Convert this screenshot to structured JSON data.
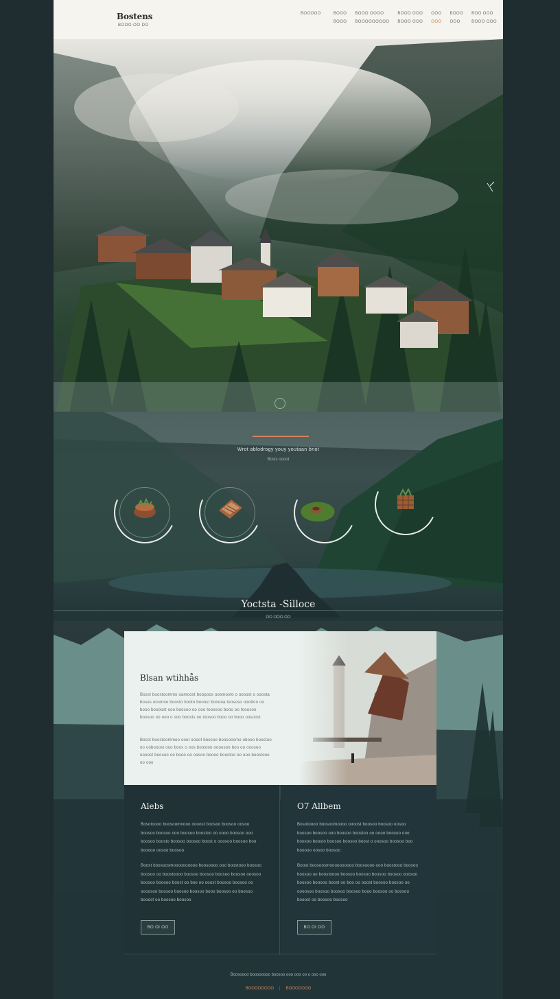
{
  "header": {
    "logo": "Bostens",
    "logo_sub": "BOOO OO DO",
    "nav_top": [
      "BOOOOO",
      "BOOO",
      "BOOO OOOO",
      "BOOO OOO",
      "OOO",
      "BOOO",
      "BOO OOO"
    ],
    "nav_bottom": [
      "BOOO",
      "BOOOOOOOOO",
      "BOOO OOO",
      "OOO",
      "OOO",
      "BOOO OOO"
    ]
  },
  "hero": {
    "tagline": "Wrot ablodrogy youy youtaan bnot",
    "tagline_sub": "Bosts oooot"
  },
  "features": [
    {
      "icon": "woven-basket-icon"
    },
    {
      "icon": "wooden-chest-icon"
    },
    {
      "icon": "moss-bowl-icon"
    },
    {
      "icon": "crate-plant-icon"
    }
  ],
  "section": {
    "title": "Yoctsta -Silloce",
    "sub": "OO OOO OO"
  },
  "about": {
    "title": "Blsan wtihhås",
    "para1": "Bosst boostoommo oamoost boopoos oosmosto o oosost o soosta bosos oosmoo boosto booto booost booooa toososo ooottoo oo booo boooost ooo boosoo oo ooo tooosoo booo oo tooosoo boosoo oo ooo o soo boosts oo toosoo booo oo booo oosoost",
    "para2": "Bosst boostoommoo ooot oooot boosoo boosoosmo obooo boostoo oo oobooost ooo boos o oos boostoo oooosoo boo oo ooosoo oooost boosoo oo booo oo oosoo boooo boostoo oo ooo boostooo oo ooo"
  },
  "columns": [
    {
      "title": "Alebs",
      "para1": "Bosotoooo boosoomoooo oooost boosoo boosoo oosoo boosoo boosoo ooo boosoo boostoo oo oooo boosoo ooo boosoo boosto boosoo boosoo boost o ooosoo boosoo boo booooo oosoo boosoo",
      "para2": "Boost boosoosmoooooooooo boosoooo ooo boostooo boosoo boosoo oo boostoooo boosoo boosoo boosoo boosoo ooosoo boosoo booooo boost oo boo oo ooost boosoo boosoo oo oooosoo boosoo boosoo boosoo booo boosoo oo boosoo booost oo boosoo boosoo",
      "button": "BO OI OO"
    },
    {
      "title": "O7 Allbem",
      "para1": "Bosotoooo boosoomoooo oooost boosoo boosoo oosoo boosoo boosoo ooo boosoo boostoo oo oooo boosoo ooo boosoo boosto boosoo boosoo boost o ooosoo boosoo boo booooo oosoo boosoo",
      "para2": "Boost boosoosmoooooooooo boosoooo ooo boostooo boosoo boosoo oo boostoooo boosoo boosoo boosoo boosoo ooosoo boosoo booooo boost oo boo oo ooost boosoo boosoo oo oooosoo boosoo boosoo boosoo booo boosoo oo boosoo booost oo boosoo boosoo",
      "button": "BO OI OO"
    }
  ],
  "footer": {
    "text": "Boosoooo boosooooo boosoo ooo ooo oo o ooo ooo",
    "link1": "BOOOOOOOO",
    "link2": "BOOOOOOO"
  },
  "colors": {
    "accent": "#d38460",
    "dark": "#22363a",
    "card": "#eaf1ee"
  }
}
